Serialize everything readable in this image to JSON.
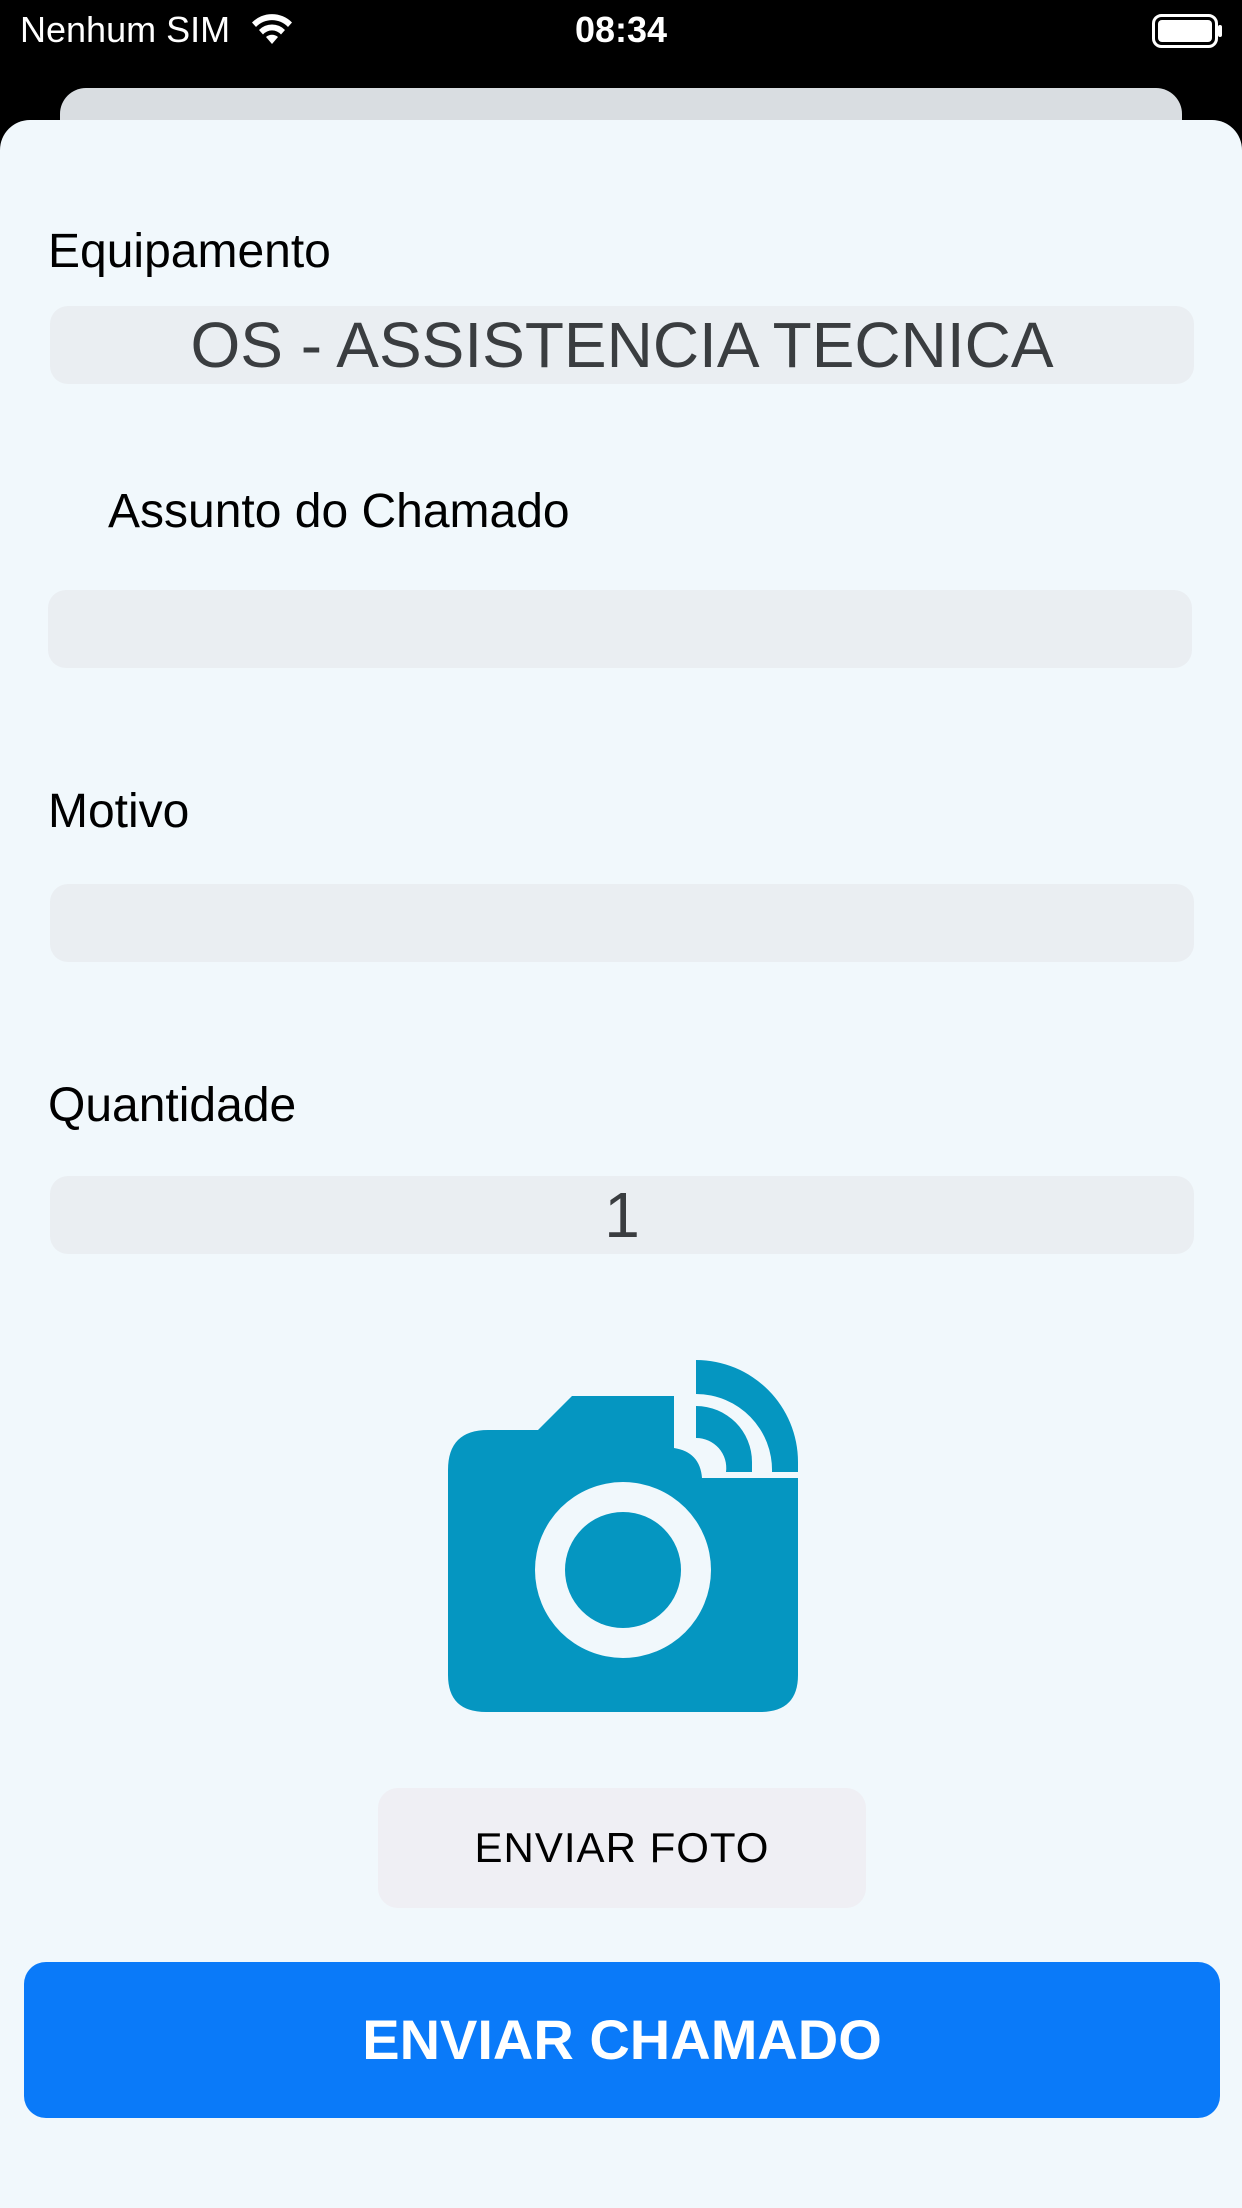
{
  "status_bar": {
    "carrier": "Nenhum SIM",
    "time": "08:34"
  },
  "form": {
    "equipamento_label": "Equipamento",
    "equipamento_value": "OS - ASSISTENCIA TECNICA",
    "assunto_label": "Assunto do Chamado",
    "assunto_value": "",
    "motivo_label": "Motivo",
    "motivo_value": "",
    "quantidade_label": "Quantidade",
    "quantidade_value": "1"
  },
  "actions": {
    "photo_button": "ENVIAR FOTO",
    "submit_button": "ENVIAR CHAMADO"
  },
  "icons": {
    "camera": "camera-wifi-icon",
    "wifi": "wifi-icon",
    "battery": "battery-icon"
  },
  "colors": {
    "accent": "#0a7af9",
    "camera": "#0596c1",
    "sheet_background": "#f1f8fc",
    "field_background": "#eaeef2"
  }
}
